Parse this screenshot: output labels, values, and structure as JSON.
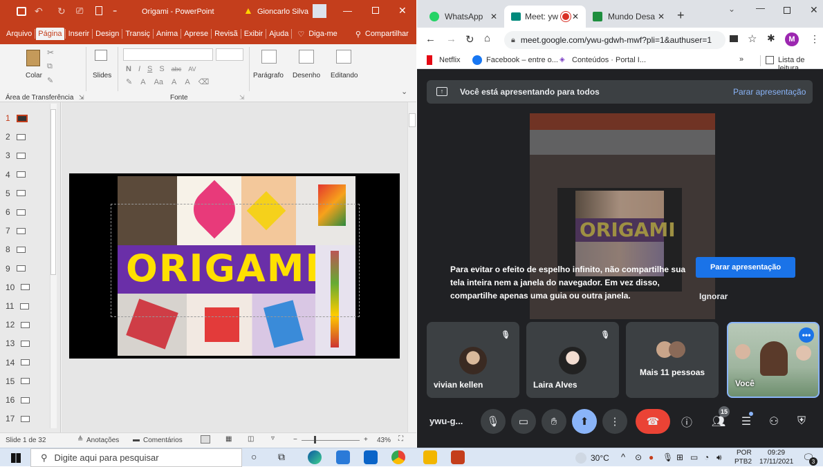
{
  "ppt": {
    "title": "Origami  -  PowerPoint",
    "user_warning": "Gioncarlo Silva",
    "tabs": [
      "Arquivo",
      "Página",
      "Inserir",
      "Design",
      "Transiç",
      "Anima",
      "Aprese",
      "Revisã",
      "Exibir",
      "Ajuda"
    ],
    "active_tab": "Página",
    "tell_me": "Diga-me",
    "share": "Compartilhar",
    "ribbon": {
      "paste": "Colar",
      "clipboard": "Área de Transferência",
      "slides": "Slides",
      "font_group": "Fonte",
      "paragraph": "Parágrafo",
      "drawing": "Desenho",
      "editing": "Editando",
      "font_buttons": [
        "N",
        "I",
        "S",
        "S",
        "abc",
        "AV",
        "A",
        "Aa",
        "A",
        "A"
      ]
    },
    "slide_numbers": [
      "1",
      "2",
      "3",
      "4",
      "5",
      "6",
      "7",
      "8",
      "9",
      "10",
      "11",
      "12",
      "13",
      "14",
      "15",
      "16",
      "17"
    ],
    "slide_title": "ORIGAMI",
    "status": {
      "slide": "Slide 1 de 32",
      "notes": "Anotações",
      "comments": "Comentários",
      "zoom": "43%"
    }
  },
  "chrome": {
    "tabs": [
      {
        "label": "WhatsApp",
        "color": "#25d366"
      },
      {
        "label": "Meet: yw",
        "color": "#00897b"
      },
      {
        "label": "Mundo Desa",
        "color": "#1e8e3e"
      }
    ],
    "url": "meet.google.com/ywu-gdwh-mwf?pli=1&authuser=1",
    "profile_initial": "M",
    "bookmarks": [
      "Netflix",
      "Facebook – entre o...",
      "Conteúdos · Portal I..."
    ],
    "reading_list": "Lista de leitura",
    "overflow": "»"
  },
  "meet": {
    "banner_text": "Você está apresentando para todos",
    "stop_link": "Parar apresentação",
    "warning": "Para evitar o efeito de espelho infinito, não compartilhe sua tela inteira nem a janela do navegador. Em vez disso, compartilhe apenas uma guia ou outra janela.",
    "stop_button": "Parar apresentação",
    "ignore": "Ignorar",
    "participants": [
      {
        "name": "vivian kellen"
      },
      {
        "name": "Laira Alves"
      },
      {
        "name": "Mais 11 pessoas"
      },
      {
        "name": "Você"
      }
    ],
    "meeting_code": "ywu-g...",
    "people_count": "15"
  },
  "taskbar": {
    "search_placeholder": "Digite aqui para pesquisar",
    "temperature": "30°C",
    "lang_top": "POR",
    "lang_bottom": "PTB2",
    "time": "09:29",
    "date": "17/11/2021",
    "notifications": "3"
  }
}
